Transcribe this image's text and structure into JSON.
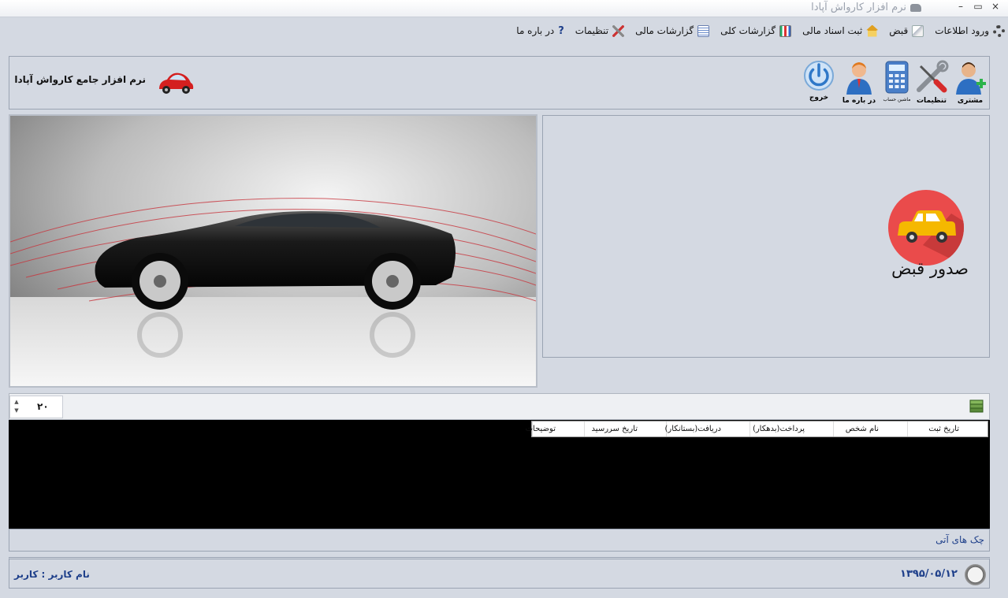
{
  "window": {
    "title": "نرم افزار کارواش آپادا",
    "close_glyph": "×",
    "maximize_glyph": "▭",
    "minimize_glyph": "–"
  },
  "menu": [
    {
      "label": "ورود اطلاعات",
      "icon": "gear-icon"
    },
    {
      "label": "قبض",
      "icon": "receipt-icon"
    },
    {
      "label": "ثبت اسناد مالی",
      "icon": "house-icon"
    },
    {
      "label": "گزارشات کلی",
      "icon": "bar-chart-icon"
    },
    {
      "label": "گزارشات مالی",
      "icon": "report-icon"
    },
    {
      "label": "تنظیمات",
      "icon": "wrench-icon"
    },
    {
      "label": "در باره ما",
      "icon": "help-icon"
    }
  ],
  "help_glyph": "?",
  "toolbar": {
    "customer": "مشتری",
    "settings": "تنظیمات",
    "calculator": "ماشین حساب",
    "about": "در باره ما",
    "exit": "خروج",
    "app_title": "نرم افزار جامع کارواش آپادا"
  },
  "action": {
    "issue_receipt": "صدور قبض"
  },
  "grid": {
    "page_size": "۲۰",
    "spin_up": "▲",
    "spin_down": "▼",
    "columns": [
      "تاریخ ثبت",
      "نام شخص",
      "پرداخت(بدهکار)",
      "دریافت(بستانکار)",
      "تاریخ سررسید",
      "توضیحات"
    ]
  },
  "checks_label": "چک های آتی",
  "status": {
    "date": "۱۳۹۵/۰۵/۱۲",
    "user": "نام کاربر : کاربر"
  },
  "colors": {
    "accent_red": "#ea4b4b",
    "status_text": "#1e3f8a",
    "background": "#d4d9e2"
  }
}
